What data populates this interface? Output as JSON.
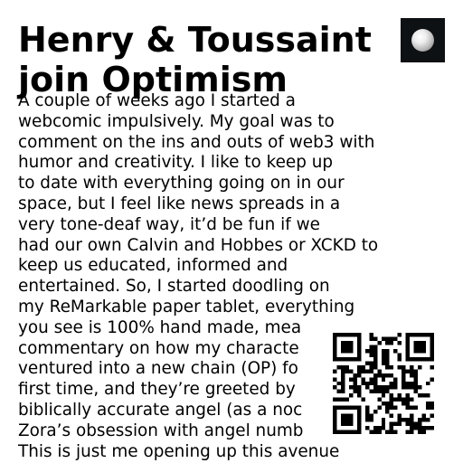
{
  "title": {
    "line1": "Henry & Toussaint",
    "line2": "join Optimism"
  },
  "body": {
    "lines": [
      "A couple of weeks ago I started a",
      "webcomic impulsively. My goal was to",
      "comment on the ins and outs of web3 with",
      "humor and creativity.  I like to keep up",
      "to date with everything going on in our",
      "space, but I feel like news spreads in a",
      "very tone-deaf way, it’d be fun if we",
      "had our own Calvin and Hobbes or XCKD to",
      "keep us educated, informed and",
      "entertained. So, I started doodling on",
      "my ReMarkable paper tablet, everything",
      "you see is 100% hand made, mea",
      "commentary on how my characte",
      "ventured into a new chain (OP) fo",
      "first time, and they’re greeted by",
      "biblically accurate angel (as a noc",
      "Zora’s obsession with angel numb",
      "This is just me opening up this avenue"
    ]
  },
  "icons": {
    "avatar": "avatar-orb-icon",
    "qr": "qr-code-icon"
  },
  "colors": {
    "text": "#000000",
    "background": "#ffffff",
    "avatar_bg": "#0d1113"
  }
}
